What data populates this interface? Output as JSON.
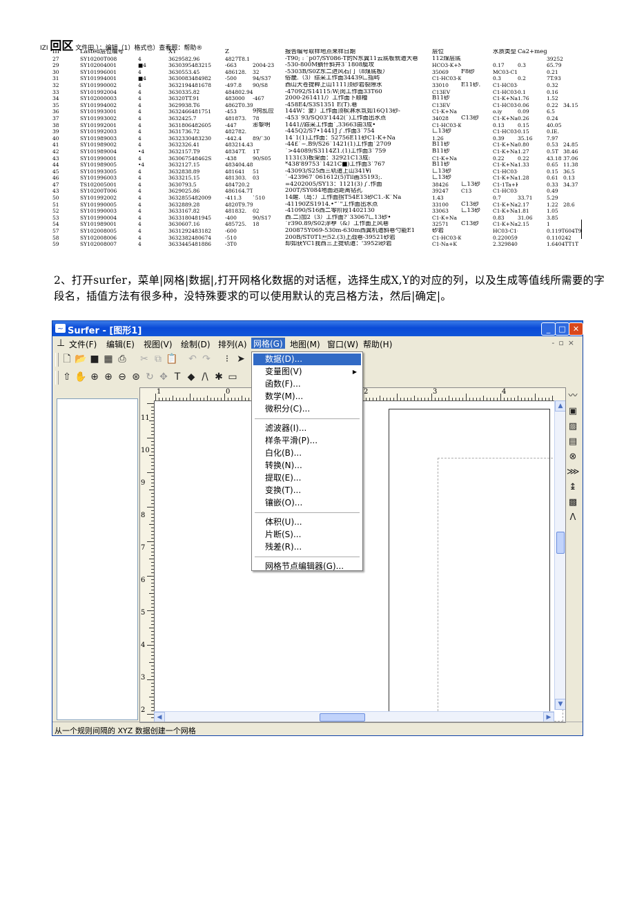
{
  "header_line": {
    "prefix": "IZI",
    "big": "回区",
    "rest": "文件田.）：编辑（1）格式也）查看照：帮助®"
  },
  "table": {
    "columns": [
      "III",
      "Lasted层位编号",
      "",
      "XY",
      "Z",
      "",
      "报告编号取样地点来样日期",
      "层位",
      "",
      "水质类型",
      "Ca2+meg/L",
      ""
    ],
    "rows": [
      [
        "27",
        "SY10200T008",
        "4",
        "3629582.96",
        "4827T8.1",
        "",
        "-T90;  : `p07/SY086-T的N东翼11云底板就道大巷",
        "112煤层底投砂岩述",
        "",
        "",
        "",
        "39252"
      ],
      [
        "29",
        "SY102004001",
        "■4",
        "3630395483215",
        "-663",
        "2004-23",
        "-530-800M躺什斜井3`1808艇攻",
        "HCO3-K+Na",
        "",
        "0.17",
        "0.3",
        "65.79"
      ],
      [
        "30",
        "SY101996001",
        "4",
        "3630553.45",
        "486128.",
        "32",
        "-5303B/S0Z东二进风石门（8煤底板）",
        "35069",
        "F8砂",
        "MC03-C1-K+Na",
        "",
        "0.21"
      ],
      [
        "31",
        "SY101994001",
        "■4",
        "3630083484982",
        "-500",
        "94/S37",
        "俗畿.（3）综采工作面34439匚指屿",
        "C1-HC03-K+Na",
        "",
        "0.3",
        "0.2",
        "7T.93"
      ],
      [
        "32",
        "SY101990002",
        "4",
        "3632194481678",
        "-497.8",
        "90/S8",
        "西山大苍提粹上山1111顶砂岩裂隙水",
        "33010",
        "E11砂.",
        "C1-HC03-K+Na",
        "",
        "0.32"
      ],
      [
        "33",
        "SY101992004",
        "4",
        "3630335.82",
        "484802.94",
        "",
        "-47092/S14115:W;闵工作面33T60",
        "C13EV",
        "",
        "C1-HC03-K+Na",
        "0.1",
        "0.16"
      ],
      [
        "34",
        "SY102000003",
        "4",
        "36320TT.91",
        "483000",
        "-467",
        "2000-261411/）工作面下顺槽",
        "B11砂",
        "",
        "C1-K+Na",
        "1.76",
        "1.52"
      ],
      [
        "35",
        "SY101994002",
        "4",
        "3629938.T6",
        "4862T0.39",
        "",
        "-458E4/S3S1351 E(T).巷",
        "C13EV",
        "",
        "C1-HC03-K+Na",
        "0.06",
        "0.22"
      ],
      [
        "36",
        "SY101993001",
        "4",
        "3632466481751",
        "-453",
        "9拘乱应",
        "144W：蒙）工作面顶槟淋水氛如16Q13砂-",
        "C1-K+Na",
        "",
        "o.iy",
        "0.09",
        "6.5"
      ],
      [
        "37",
        "SY101993002",
        "4",
        "3632425.7",
        "481873.",
        "78",
        "-453`93/SQ03'1442(`)工作面出水点",
        "34028",
        "C13砂",
        "C1-K+Na",
        "0.26",
        "0.24"
      ],
      [
        "38",
        "SY101992001",
        "4",
        "3631806482605",
        "-447",
        "澎黎明",
        "1441//踪采工作面`,33663由3成•",
        "C1-HC03-K+IU",
        "",
        "0.13",
        "0.15",
        "40.05"
      ],
      [
        "39",
        "SY101992003",
        "4",
        "3631736.72",
        "482782.",
        "",
        "-445Q2/S7•1441J了.作面3`754",
        "匚13砂",
        "",
        "C1-HC03-K+Na",
        "0.15",
        "0.IE."
      ],
      [
        "40",
        "SY101989003",
        "4",
        "3632330483230",
        "-442.4",
        "89/`30",
        "14`1(1)工作面：52756E11砂C1-K+Na",
        "1.26",
        "",
        "0.39",
        "35.16",
        "7.97"
      ],
      [
        "41",
        "SY101989002",
        "4",
        "3632326.41",
        "483214.43",
        "",
        "-44£`~.B9/S26`1421(1)工作面`2709",
        "B11砂",
        "",
        "C1-K+Na",
        "0.80",
        "0.53"
      ],
      [
        "42",
        "SY101989004",
        "•4",
        "3632157.T9",
        "48347T.",
        "1T",
        "`>44089/S3114Z1.(1)工作面3`759",
        "B11砂",
        "",
        "C1-K+Na",
        "1.27",
        "0.5T"
      ],
      [
        "43",
        "SY101990001",
        "4",
        "363067548462S",
        "-438",
        "90/S05",
        "1131(3)板架面：32921C13成:",
        "C1-K+Na",
        "",
        "0.22",
        "0.22",
        "43.18"
      ],
      [
        "44",
        "SY101989005",
        "•4",
        "3632127.15",
        "483404.48",
        "",
        "*438'89753`1421C■)工作面3`767",
        "B11砂",
        "",
        "C1-K+Na",
        "1.33",
        "0.65"
      ],
      [
        "45",
        "SY101993005",
        "4",
        "3632838.89",
        "481641",
        "51",
        "-43093/S25西三轨道上山341¥i",
        "匚13砂",
        "",
        "C1-HC03-K+Na",
        "",
        "0.15"
      ],
      [
        "46",
        "SY101996003",
        "4",
        "3633215.15",
        "481303.",
        "03",
        "`-423967`061612(5)Til画35193;.",
        "匚13砂",
        "",
        "C1-K+Na",
        "1.28",
        "0.61"
      ],
      [
        "47",
        "TS102005001",
        "4",
        "3630793.5",
        "484720.2",
        "",
        "=4202005/SY13：1121(3)了.作面",
        "38426",
        "匚13砂",
        "C1-1Ta+K",
        "",
        "0.33"
      ],
      [
        "43",
        "SY10200T006",
        "4",
        "3629025.86",
        "486164.7T",
        "",
        "200T/SY084地面远距离钻孔",
        "39247",
        "C13",
        "C1-HC03-K+Na",
        "",
        "0.49"
      ],
      [
        "50",
        "SY101992002",
        "4",
        "3632855482009",
        "-411.3",
        "`510",
        "14醒.（岛：）工作面拐T54E13砂C1.-K`Na",
        "1.43",
        "",
        "0.7",
        "33.71",
        "5.29"
      ],
      [
        "51",
        "SY101990005",
        "4",
        "3632889.28",
        "4820T9.79",
        "",
        "-41190ZS1914.•“`\"工作面出水点",
        "33100",
        "C13砂",
        "C1-K+Na",
        "2.17",
        "1.22"
      ],
      [
        "52",
        "SY101990003",
        "4",
        "3633167.82",
        "481832.",
        "02",
        "-41090/S16西二零阶段1402130",
        "33063",
        "匚13砂",
        "C1-K+Na",
        "1.81",
        "1.05"
      ],
      [
        "53",
        "SY101990004",
        "4",
        "3633180481945",
        "-400",
        "90/S17",
        "西.二)加2（3）工作面?`33067匚13砂•",
        "C1-K+Na",
        "",
        "0.83",
        "31.06",
        "3.85"
      ],
      [
        "54",
        "SY101989001",
        "4",
        "3630607.16",
        "485725.",
        "18",
        "`r390.89/S02浮咿（&）工作面上风巷",
        "32571",
        "C13砂",
        "C1-K+Na",
        "2.15",
        "1"
      ],
      [
        "57",
        "SY102008005",
        "4",
        "3631292483182",
        "-600",
        "",
        "200875Y069-530m-630m西翼机道斜巷勺能E1",
        "砂岩",
        "",
        "HC03-C1-K+Na",
        "",
        "0.119T604T9"
      ],
      [
        "58",
        "SY102008006",
        "4",
        "3632382480674",
        "-510",
        "",
        "200B/ST0T1\b52.(3)上战巷-39521砂岩",
        "C1-HC03-K+Na",
        "",
        "0.22005988",
        "",
        "0.110242"
      ],
      [
        "59",
        "SY102008007",
        "4",
        "3633445481886",
        "-3T0",
        "",
        "却如获YC1我西三上提轨道：'3952i砂岩",
        "C1-Na+K",
        "",
        "2.329840319",
        "",
        "1.6404TT1T"
      ]
    ],
    "extra_right": [
      "",
      "",
      "",
      "",
      "",
      "",
      "",
      "34.15",
      "",
      "",
      "",
      "",
      "",
      "24.85",
      "38.46",
      "37.06",
      "11.38",
      "36.5",
      "0.13",
      "34.37",
      "",
      "",
      "28.6",
      "",
      "",
      "",
      "",
      "",
      "",
      ""
    ]
  },
  "paragraph": "2、打开surfer，菜单|网格|数据|,打开网格化数据的对话框，选择生成X,Y的对应的列，以及生成等值线所需要的字段名，插值方法有很多种，没特殊要求的可以使用默认的克吕格方法，然后|确定|。",
  "window": {
    "title": "Surfer - [图形1]",
    "menus": [
      "文件(F)",
      "编辑(E)",
      "视图(V)",
      "绘制(D)",
      "排列(A)",
      "网格(G)",
      "地图(M)",
      "窗口(W)",
      "帮助(H)"
    ],
    "active_menu_index": 5,
    "dropdown": {
      "group1": [
        "数据(D)...",
        "变量图(V)",
        "函数(F)...",
        "数学(M)...",
        "微积分(C)..."
      ],
      "group2": [
        "滤波器(I)...",
        "样条平滑(P)...",
        "白化(B)...",
        "转换(N)...",
        "提取(E)...",
        "变换(T)...",
        "镶嵌(O)..."
      ],
      "group3": [
        "体积(U)...",
        "片断(S)...",
        "残差(R)..."
      ],
      "group4": [
        "网格节点编辑器(G)..."
      ],
      "highlighted": "数据(D)...",
      "submenu_item": "变量图(V)"
    },
    "hruler_labels": [
      "1",
      "0",
      "1",
      "2",
      "3",
      "4"
    ],
    "vruler_labels": [
      "11",
      "10",
      "9",
      "8",
      "7",
      "6",
      "5",
      "4",
      "3",
      "2"
    ],
    "status": "从一个规则间隔的 XYZ 数据创建一个网格"
  }
}
